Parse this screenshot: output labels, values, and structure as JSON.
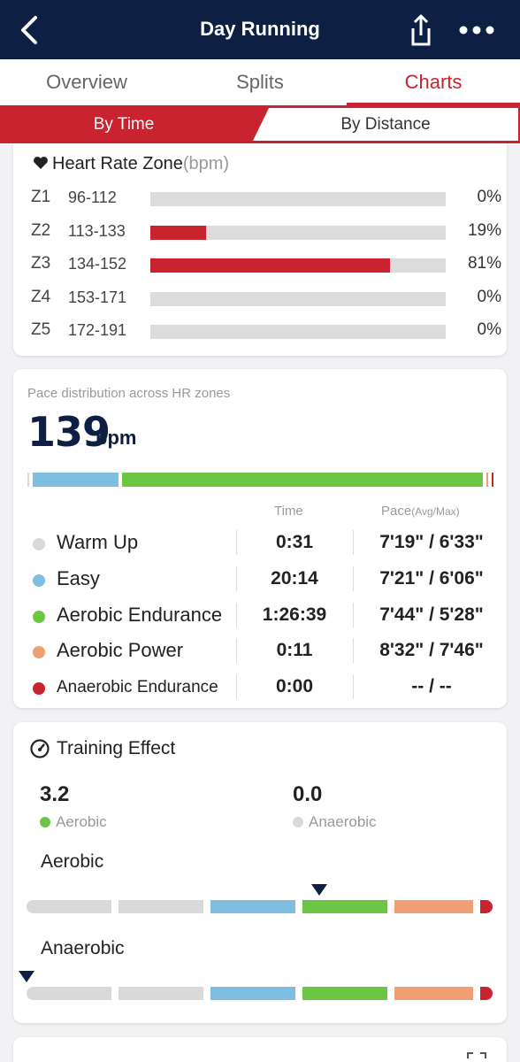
{
  "header": {
    "title": "Day Running",
    "back_icon": "chevron-left-icon",
    "share_icon": "share-icon",
    "more_icon": "more-horizontal-icon"
  },
  "tabs": [
    {
      "label": "Overview",
      "active": false
    },
    {
      "label": "Splits",
      "active": false
    },
    {
      "label": "Charts",
      "active": true
    }
  ],
  "segment": {
    "left": "By Time",
    "right": "By Distance",
    "active": "By Time"
  },
  "heart_rate_zone": {
    "title": "Heart Rate Zone",
    "unit": "(bpm)",
    "zones": [
      {
        "name": "Z1",
        "range": "96-112",
        "pct": "0%",
        "fraction": 0
      },
      {
        "name": "Z2",
        "range": "113-133",
        "pct": "19%",
        "fraction": 0.19
      },
      {
        "name": "Z3",
        "range": "134-152",
        "pct": "81%",
        "fraction": 0.81
      },
      {
        "name": "Z4",
        "range": "153-171",
        "pct": "0%",
        "fraction": 0
      },
      {
        "name": "Z5",
        "range": "172-191",
        "pct": "0%",
        "fraction": 0
      }
    ]
  },
  "pace_distribution": {
    "caption": "Pace distribution across HR zones",
    "value": "139",
    "unit": "bpm",
    "col_time": "Time",
    "col_pace": "Pace",
    "col_pace_sub": "(Avg/Max)",
    "bar_fractions": [
      0.004,
      0.19,
      0.8,
      0.004,
      0.002
    ],
    "rows": [
      {
        "name": "Warm Up",
        "color": "#d9d9d9",
        "time": "0:31",
        "pace": "7'19\" / 6'33\""
      },
      {
        "name": "Easy",
        "color": "#7fbde2",
        "time": "20:14",
        "pace": "7'21\" / 6'06\""
      },
      {
        "name": "Aerobic Endurance",
        "color": "#6cc644",
        "time": "1:26:39",
        "pace": "7'44\" / 5'28\""
      },
      {
        "name": "Aerobic Power",
        "color": "#ef9f73",
        "time": "0:11",
        "pace": "8'32\" / 7'46\""
      },
      {
        "name": "Anaerobic Endurance",
        "color": "#c8232f",
        "time": "0:00",
        "pace": "-- / --"
      }
    ]
  },
  "training_effect": {
    "title": "Training Effect",
    "icon": "speedometer-icon",
    "aerobic_value": "3.2",
    "aerobic_label": "Aerobic",
    "anaerobic_value": "0.0",
    "anaerobic_label": "Anaerobic",
    "aerobic_scale_label": "Aerobic",
    "anaerobic_scale_label": "Anaerobic",
    "aerobic_level": 3.2,
    "anaerobic_level": 0.0,
    "scale_colors": [
      "#d9d9d9",
      "#d9d9d9",
      "#7fbde2",
      "#6cc644",
      "#ef9f73",
      "#c8232f"
    ]
  },
  "bottom_card": {
    "icon": "expand-icon"
  }
}
